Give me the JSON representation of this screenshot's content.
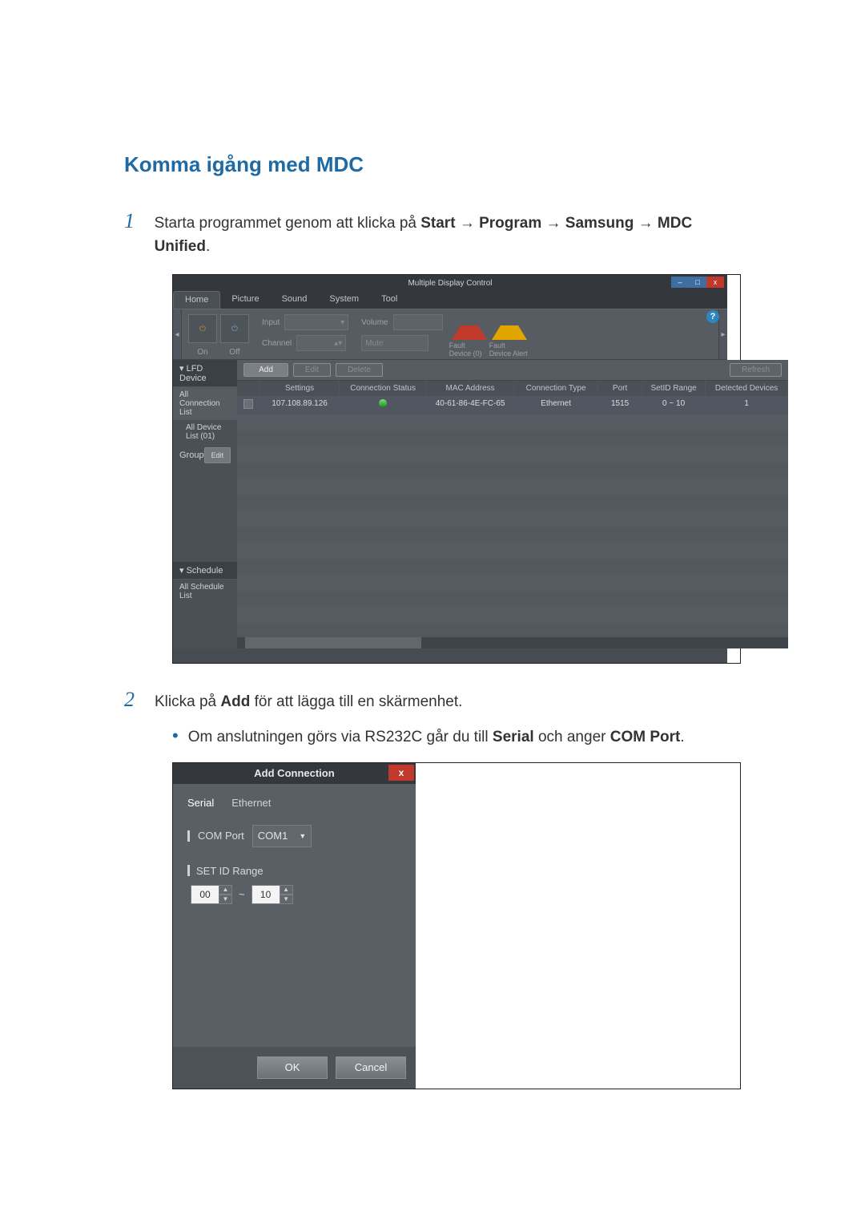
{
  "heading": "Komma igång med MDC",
  "step1": {
    "num": "1",
    "pre": "Starta programmet genom att klicka på",
    "s1": "Start",
    "a1": "→",
    "s2": "Program",
    "a2": "→",
    "s3": "Samsung",
    "a3": "→",
    "s4": "MDC Unified",
    "tail": "."
  },
  "step2": {
    "num": "2",
    "pre": "Klicka på",
    "b1": "Add",
    "post": "för att lägga till en skärmenhet."
  },
  "bullet": {
    "pre": "Om anslutningen görs via RS232C går du till",
    "b1": "Serial",
    "mid": "och anger",
    "b2": "COM Port",
    "tail": "."
  },
  "mdc": {
    "title": "Multiple Display Control",
    "help": "?",
    "tabs": [
      "Home",
      "Picture",
      "Sound",
      "System",
      "Tool"
    ],
    "ribbon": {
      "on": "On",
      "off": "Off",
      "input_l": "Input",
      "channel_l": "Channel",
      "volume_l": "Volume",
      "mute_l": "Mute",
      "fd": "Fault Device (0)",
      "fa": "Fault Device Alert"
    },
    "side": {
      "lfd": "LFD Device",
      "acl": "All Connection List",
      "adl": "All Device List (01)",
      "group": "Group",
      "edit": "Edit",
      "sched": "Schedule",
      "asl": "All Schedule List"
    },
    "toolbar": {
      "add": "Add",
      "edit": "Edit",
      "delete": "Delete",
      "refresh": "Refresh"
    },
    "thead": [
      "",
      "Settings",
      "Connection Status",
      "MAC Address",
      "Connection Type",
      "Port",
      "SetID Range",
      "Detected Devices"
    ],
    "row": [
      "",
      "107.108.89.126",
      "",
      "40-61-86-4E-FC-65",
      "Ethernet",
      "1515",
      "0 ~ 10",
      "1"
    ]
  },
  "dlg": {
    "title": "Add Connection",
    "tabs": [
      "Serial",
      "Ethernet"
    ],
    "comport_l": "COM Port",
    "comport_v": "COM1",
    "setid_l": "SET ID Range",
    "from": "00",
    "to": "10",
    "ok": "OK",
    "cancel": "Cancel"
  }
}
